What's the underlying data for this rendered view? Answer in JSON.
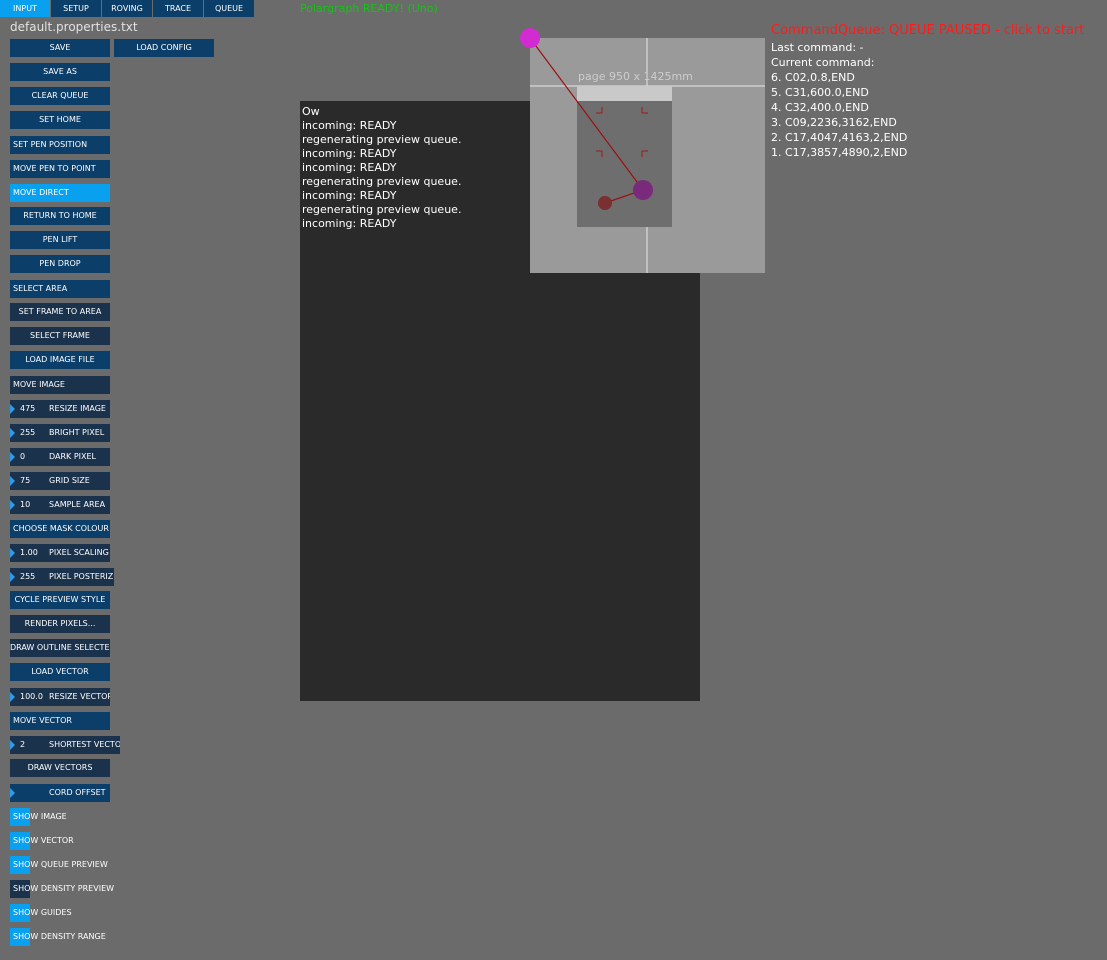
{
  "tabs": [
    {
      "label": "Input",
      "active": true
    },
    {
      "label": "Setup",
      "active": false
    },
    {
      "label": "Roving",
      "active": false
    },
    {
      "label": "Trace",
      "active": false
    },
    {
      "label": "Queue",
      "active": false
    }
  ],
  "status_ready": "Polargraph READY! (Uno)",
  "filename": "default.properties.txt",
  "buttons": {
    "save": "Save",
    "load_config": "Load Config",
    "save_as": "Save As",
    "clear_queue": "Clear Queue",
    "set_home": "Set Home",
    "set_pen_position": "Set Pen Position",
    "move_pen_to_point": "Move Pen To Point",
    "move_direct": "Move Direct",
    "return_to_home": "Return To Home",
    "pen_lift": "Pen Lift",
    "pen_drop": "Pen Drop",
    "select_area": "Select Area",
    "set_frame_to_area": "Set Frame To Area",
    "select_frame": "Select Frame",
    "load_image_file": "Load Image File",
    "move_image": "Move Image",
    "choose_mask_colour": "Choose Mask Colour",
    "cycle_preview_style": "Cycle Preview Style",
    "render_pixels": "Render Pixels...",
    "draw_outline_selected": "Draw Outline Selected",
    "load_vector": "Load Vector",
    "move_vector": "Move Vector",
    "draw_vectors": "Draw Vectors"
  },
  "number_controls": {
    "resize_image": {
      "value": "475",
      "label": "Resize Image"
    },
    "bright_pixel": {
      "value": "255",
      "label": "Bright Pixel"
    },
    "dark_pixel": {
      "value": "0",
      "label": "Dark Pixel"
    },
    "grid_size": {
      "value": "75",
      "label": "Grid Size"
    },
    "sample_area": {
      "value": "10",
      "label": "Sample Area"
    },
    "pixel_scaling": {
      "value": "1.00",
      "label": "Pixel Scaling"
    },
    "pixel_posterize": {
      "value": "255",
      "label": "Pixel Posterize"
    },
    "resize_vector": {
      "value": "100.0",
      "label": "Resize Vector"
    },
    "shortest_vector": {
      "value": "2",
      "label": "Shortest Vector"
    },
    "cord_offset": {
      "value": "",
      "label": "Cord Offset"
    }
  },
  "toggles": {
    "show_image": {
      "label": "Show Image",
      "on": true
    },
    "show_vector": {
      "label": "Show Vector",
      "on": true
    },
    "show_queue_preview": {
      "label": "Show Queue Preview",
      "on": true
    },
    "show_density_preview": {
      "label": "Show Density Preview",
      "on": false
    },
    "show_guides": {
      "label": "Show Guides",
      "on": true
    },
    "show_density_range": {
      "label": "Show Density Range",
      "on": true
    }
  },
  "console": {
    "lines": [
      "Ow",
      "incoming: READY",
      "regenerating preview queue.",
      "incoming: READY",
      "incoming: READY",
      "regenerating preview queue.",
      "incoming: READY",
      "regenerating preview queue.",
      "incoming: READY"
    ]
  },
  "queue": {
    "status": "CommandQueue: QUEUE PAUSED - click to start",
    "last_command": "Last command: -",
    "current_command": "Current command:",
    "items": [
      "6. C02,0.8,END",
      "5. C31,600.0,END",
      "4. C32,400.0,END",
      "3. C09,2236,3162,END",
      "2. C17,4047,4163,2,END",
      "1. C17,3857,4890,2,END"
    ]
  },
  "page_label": "page 950 x 1425mm",
  "colors": {
    "background": "#6b6b6b",
    "button": "#0b3e68",
    "button_active": "#0aa0f0",
    "status_ready": "#12c512",
    "queue_paused": "#ff1a1a",
    "console_bg": "#2a2a2a"
  }
}
